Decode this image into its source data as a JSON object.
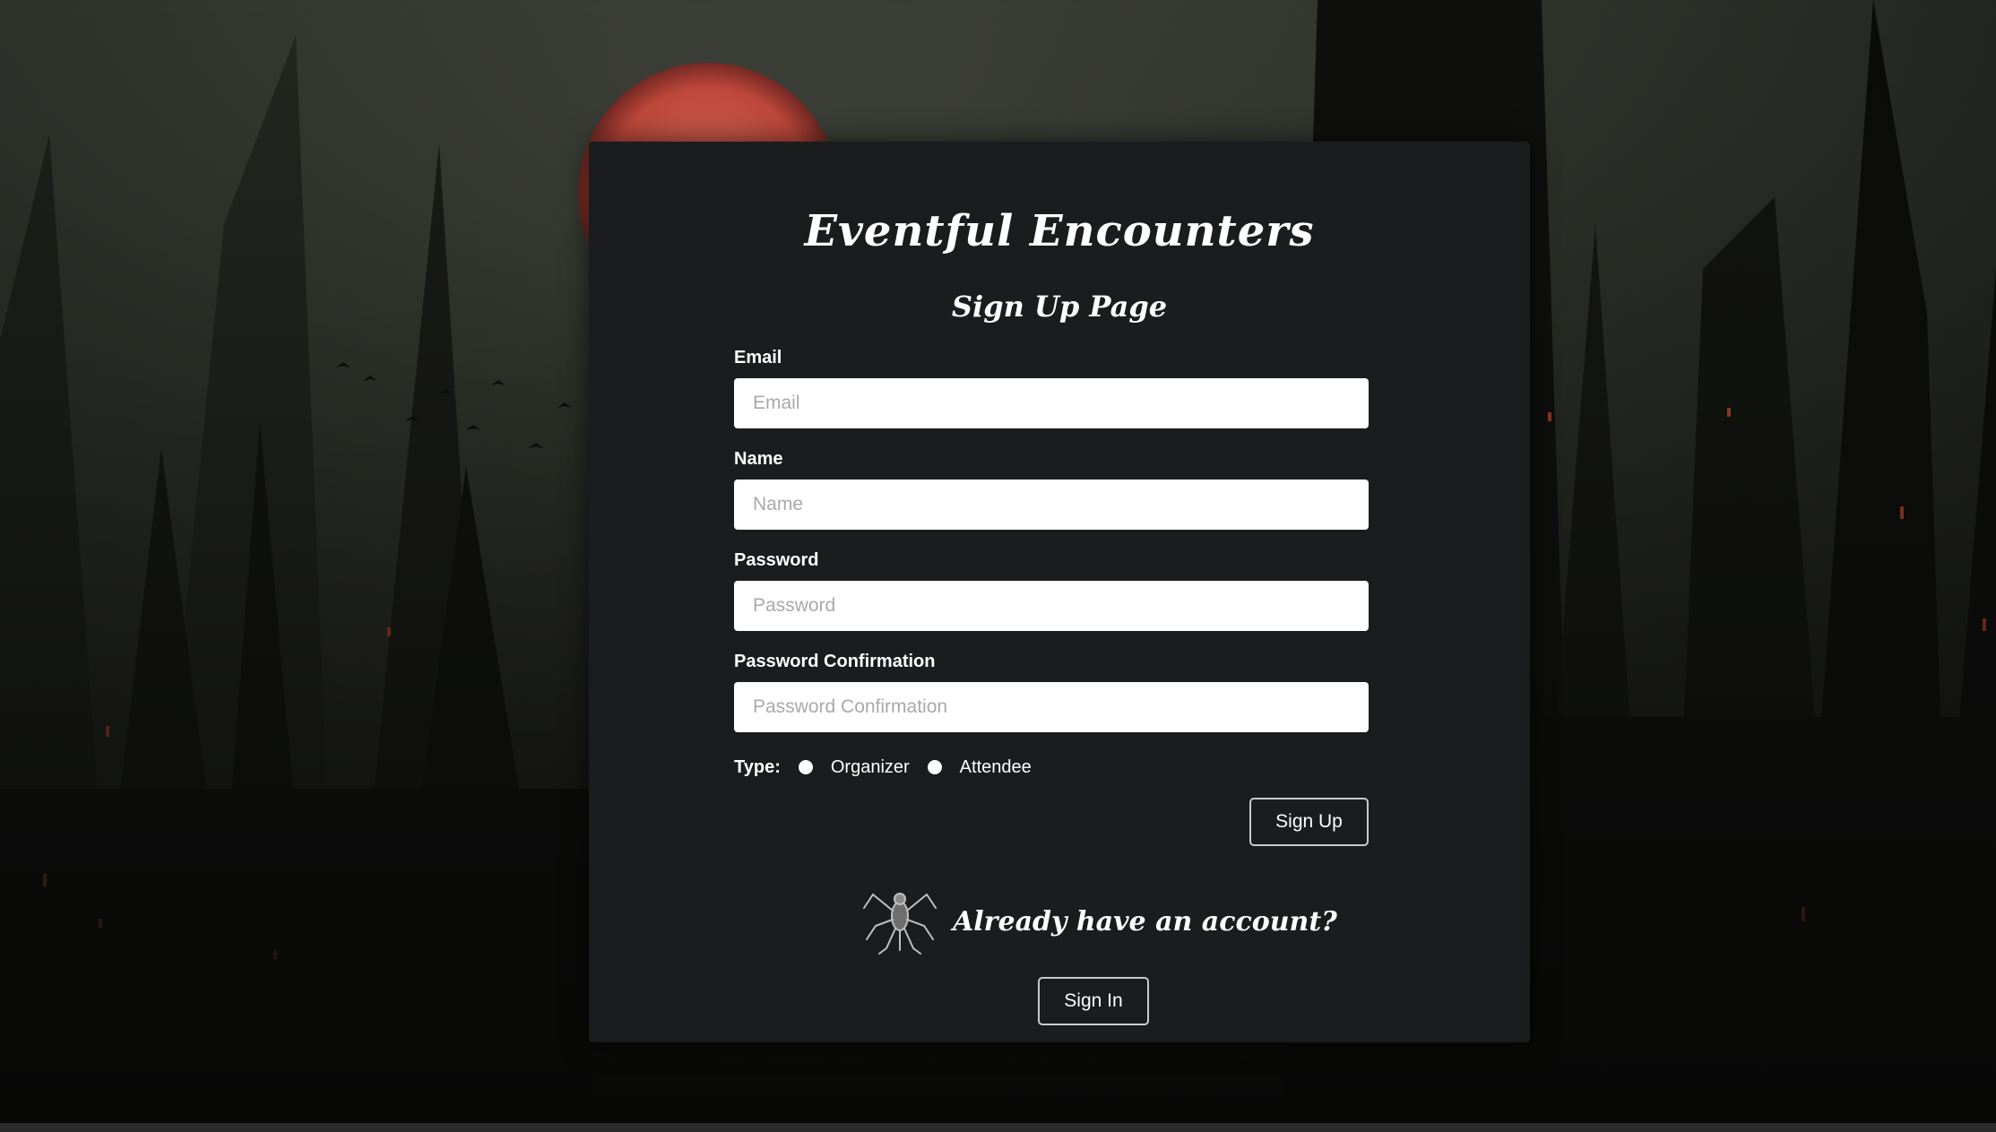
{
  "app": {
    "title": "Eventful Encounters",
    "page_title": "Sign Up Page"
  },
  "form": {
    "email": {
      "label": "Email",
      "placeholder": "Email",
      "value": ""
    },
    "name": {
      "label": "Name",
      "placeholder": "Name",
      "value": ""
    },
    "password": {
      "label": "Password",
      "placeholder": "Password",
      "value": ""
    },
    "password_confirmation": {
      "label": "Password Confirmation",
      "placeholder": "Password Confirmation",
      "value": ""
    },
    "type": {
      "label": "Type:",
      "options": [
        "Organizer",
        "Attendee"
      ],
      "selected": null
    },
    "submit_label": "Sign Up"
  },
  "signin": {
    "prompt": "Already have an account?",
    "button_label": "Sign In",
    "icon": "monster-icon"
  },
  "colors": {
    "card_bg": "#1b1c1e",
    "text": "#ffffff",
    "input_bg": "#ffffff",
    "placeholder": "#a7a9ab",
    "button_border": "#c9cacb",
    "moon": "#d9584a"
  }
}
